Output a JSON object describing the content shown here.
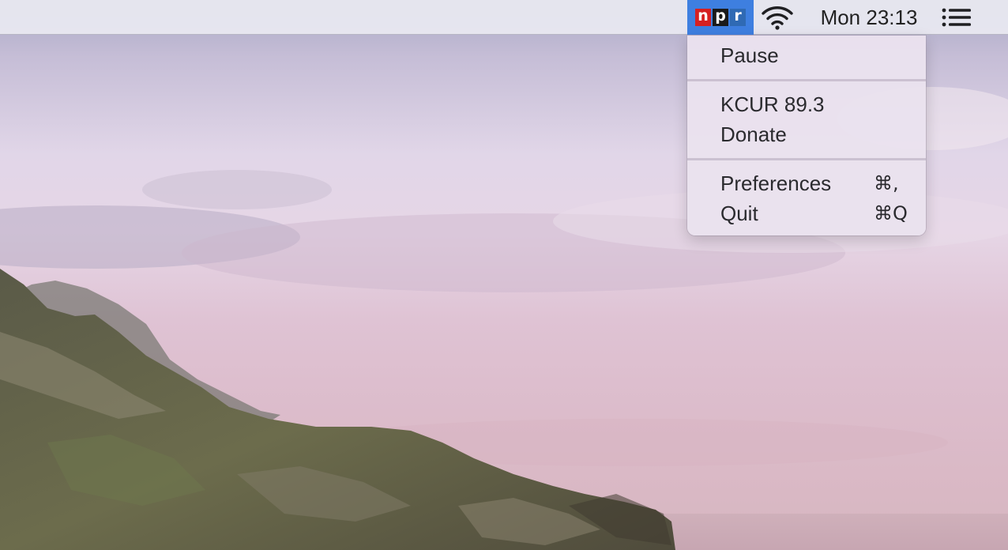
{
  "menubar": {
    "npr_logo_letters": [
      "n",
      "p",
      "r"
    ],
    "wifi_icon": "wifi-icon",
    "clock": "Mon 23:13",
    "list_icon": "list-icon",
    "colors": {
      "npr_selected_bg": "#3e7fe0",
      "npr_n": "#d62021",
      "npr_p": "#1a1a1a",
      "npr_r": "#2f6ab4"
    }
  },
  "menu": {
    "pause": "Pause",
    "station": "KCUR 89.3",
    "donate": "Donate",
    "preferences": "Preferences",
    "preferences_shortcut": "⌘,",
    "quit": "Quit",
    "quit_shortcut": "⌘Q"
  }
}
